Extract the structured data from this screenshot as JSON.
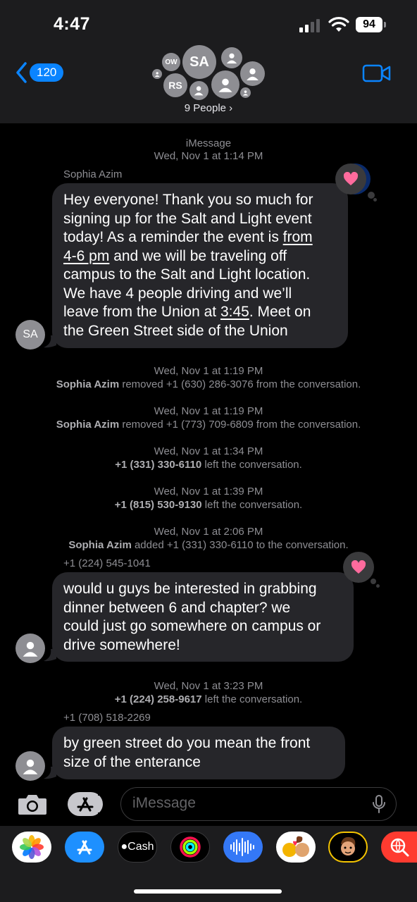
{
  "status": {
    "time": "4:47",
    "battery": "94"
  },
  "header": {
    "back_count": "120",
    "avatars": [
      {
        "initials": "OW"
      },
      {
        "initials": "SA"
      },
      {
        "initials": "RS"
      }
    ],
    "people_label": "9 People ›"
  },
  "chat": {
    "service": "iMessage",
    "first_time": "Wed, Nov 1 at 1:14 PM",
    "msg1": {
      "sender": "Sophia Azim",
      "avatar": "SA",
      "line1": "Hey everyone! Thank you so much for",
      "line2": "signing up for the Salt and Light event",
      "line3_a": "today! As a reminder the event is ",
      "line3_b": "from",
      "line4_a": "4-6 pm",
      "line4_b": " and we will be traveling off",
      "line5": "campus to the Salt and Light location.",
      "line6": "We have 4 people driving and we’ll",
      "line7_a": "leave from the Union at ",
      "line7_b": "3:45",
      "line7_c": ". Meet on",
      "line8": "the Green Street side of the Union"
    },
    "events": [
      {
        "time": "Wed, Nov 1 at 1:19 PM",
        "actor": "Sophia Azim",
        "text": " removed +1 (630) 286-3076 from the conversation."
      },
      {
        "time": "Wed, Nov 1 at 1:19 PM",
        "actor": "Sophia Azim",
        "text": " removed +1 (773) 709-6809 from the conversation."
      },
      {
        "time": "Wed, Nov 1 at 1:34 PM",
        "actor": "+1 (331) 330-6110",
        "text": " left the conversation."
      },
      {
        "time": "Wed, Nov 1 at 1:39 PM",
        "actor": "+1 (815) 530-9130",
        "text": " left the conversation."
      },
      {
        "time": "Wed, Nov 1 at 2:06 PM",
        "actor": "Sophia Azim",
        "text": " added +1 (331) 330-6110 to the conversation."
      },
      {
        "time": "Wed, Nov 1 at 3:23 PM",
        "actor": "+1 (224) 258-9617",
        "text": " left the conversation."
      }
    ],
    "msg2": {
      "sender": "+1 (224) 545-1041",
      "line1": "would u guys be interested in grabbing",
      "line2": "dinner between 6 and chapter? we",
      "line3": "could just go somewhere on campus or",
      "line4": "drive somewhere!"
    },
    "msg3": {
      "sender": "+1 (708) 518-2269",
      "line1": "by green street do you mean the front",
      "line2": "size of the enterance"
    }
  },
  "input": {
    "placeholder": "iMessage"
  },
  "apps": [
    "photos-app",
    "app-store-app",
    "apple-cash-app",
    "fitness-app",
    "audio-message-app",
    "memoji-stickers-app",
    "memoji-app",
    "search-images-app"
  ],
  "apps_cash_label": "Cash",
  "colors": {
    "accent": "#0a84ff",
    "bubble": "#26262a",
    "heart": "#ff6b9d"
  }
}
